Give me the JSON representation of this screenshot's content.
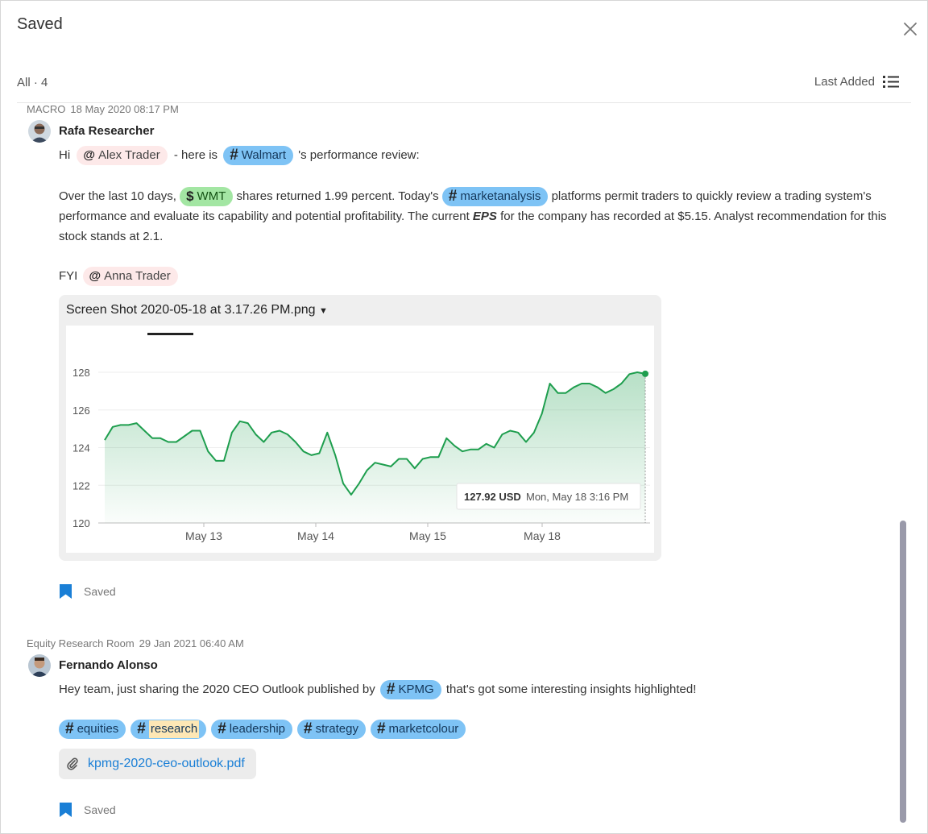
{
  "header": {
    "title": "Saved",
    "filter_label": "All · 4",
    "sort_label": "Last Added"
  },
  "posts": [
    {
      "room": "MACRO",
      "timestamp": "18 May 2020 08:17 PM",
      "author": "Rafa Researcher",
      "line1": {
        "hi": "Hi",
        "mention": "Alex Trader",
        "mid": "- here is",
        "tag": "Walmart",
        "end": "'s performance review:"
      },
      "para": {
        "p1": "Over the last 10 days,",
        "cashtag": "WMT",
        "p2": "shares returned 1.99 percent. Today's",
        "tag": "marketanalysis",
        "p3": "platforms permit traders to quickly review a trading system's performance and evaluate its capability and potential profitability. The current",
        "bold": "EPS",
        "p4": "for the company has recorded at $5.15. Analyst recommendation for this stock stands at 2.1."
      },
      "fyi": {
        "label": "FYI",
        "mention": "Anna Trader"
      },
      "attachment_name": "Screen Shot 2020-05-18 at 3.17.26 PM.png",
      "saved_label": "Saved"
    },
    {
      "room": "Equity Research Room",
      "timestamp": "29 Jan 2021 06:40 AM",
      "author": "Fernando Alonso",
      "line1": {
        "pre": "Hey team, just sharing the 2020 CEO Outlook published by",
        "tag": "KPMG",
        "post": "that's got some interesting insights highlighted!"
      },
      "tags": [
        "equities",
        "research",
        "leadership",
        "strategy",
        "marketcolour"
      ],
      "file": "kpmg-2020-ceo-outlook.pdf",
      "saved_label": "Saved"
    }
  ],
  "chart_data": {
    "type": "area",
    "x_ticks": [
      "May 13",
      "May 14",
      "May 15",
      "May 18"
    ],
    "y_ticks": [
      "120",
      "122",
      "124",
      "126",
      "128"
    ],
    "ylim": [
      120,
      129
    ],
    "values": [
      124.4,
      125.1,
      125.2,
      125.2,
      125.3,
      124.9,
      124.5,
      124.5,
      124.3,
      124.3,
      124.6,
      124.9,
      124.9,
      123.8,
      123.3,
      123.3,
      124.8,
      125.4,
      125.3,
      124.7,
      124.3,
      124.8,
      124.9,
      124.7,
      124.3,
      123.8,
      123.6,
      123.7,
      124.8,
      123.6,
      122.1,
      121.5,
      122.1,
      122.8,
      123.2,
      123.1,
      123.0,
      123.4,
      123.4,
      122.9,
      123.4,
      123.5,
      123.5,
      124.5,
      124.1,
      123.8,
      123.9,
      123.9,
      124.2,
      124.0,
      124.7,
      124.9,
      124.8,
      124.3,
      124.8,
      125.8,
      127.4,
      126.9,
      126.9,
      127.2,
      127.4,
      127.4,
      127.2,
      126.9,
      127.1,
      127.4,
      127.9,
      128.0,
      127.92
    ],
    "tooltip": {
      "price": "127.92 USD",
      "time": "Mon, May 18 3:16 PM"
    },
    "color": "#1e9e4e",
    "grid": true
  }
}
